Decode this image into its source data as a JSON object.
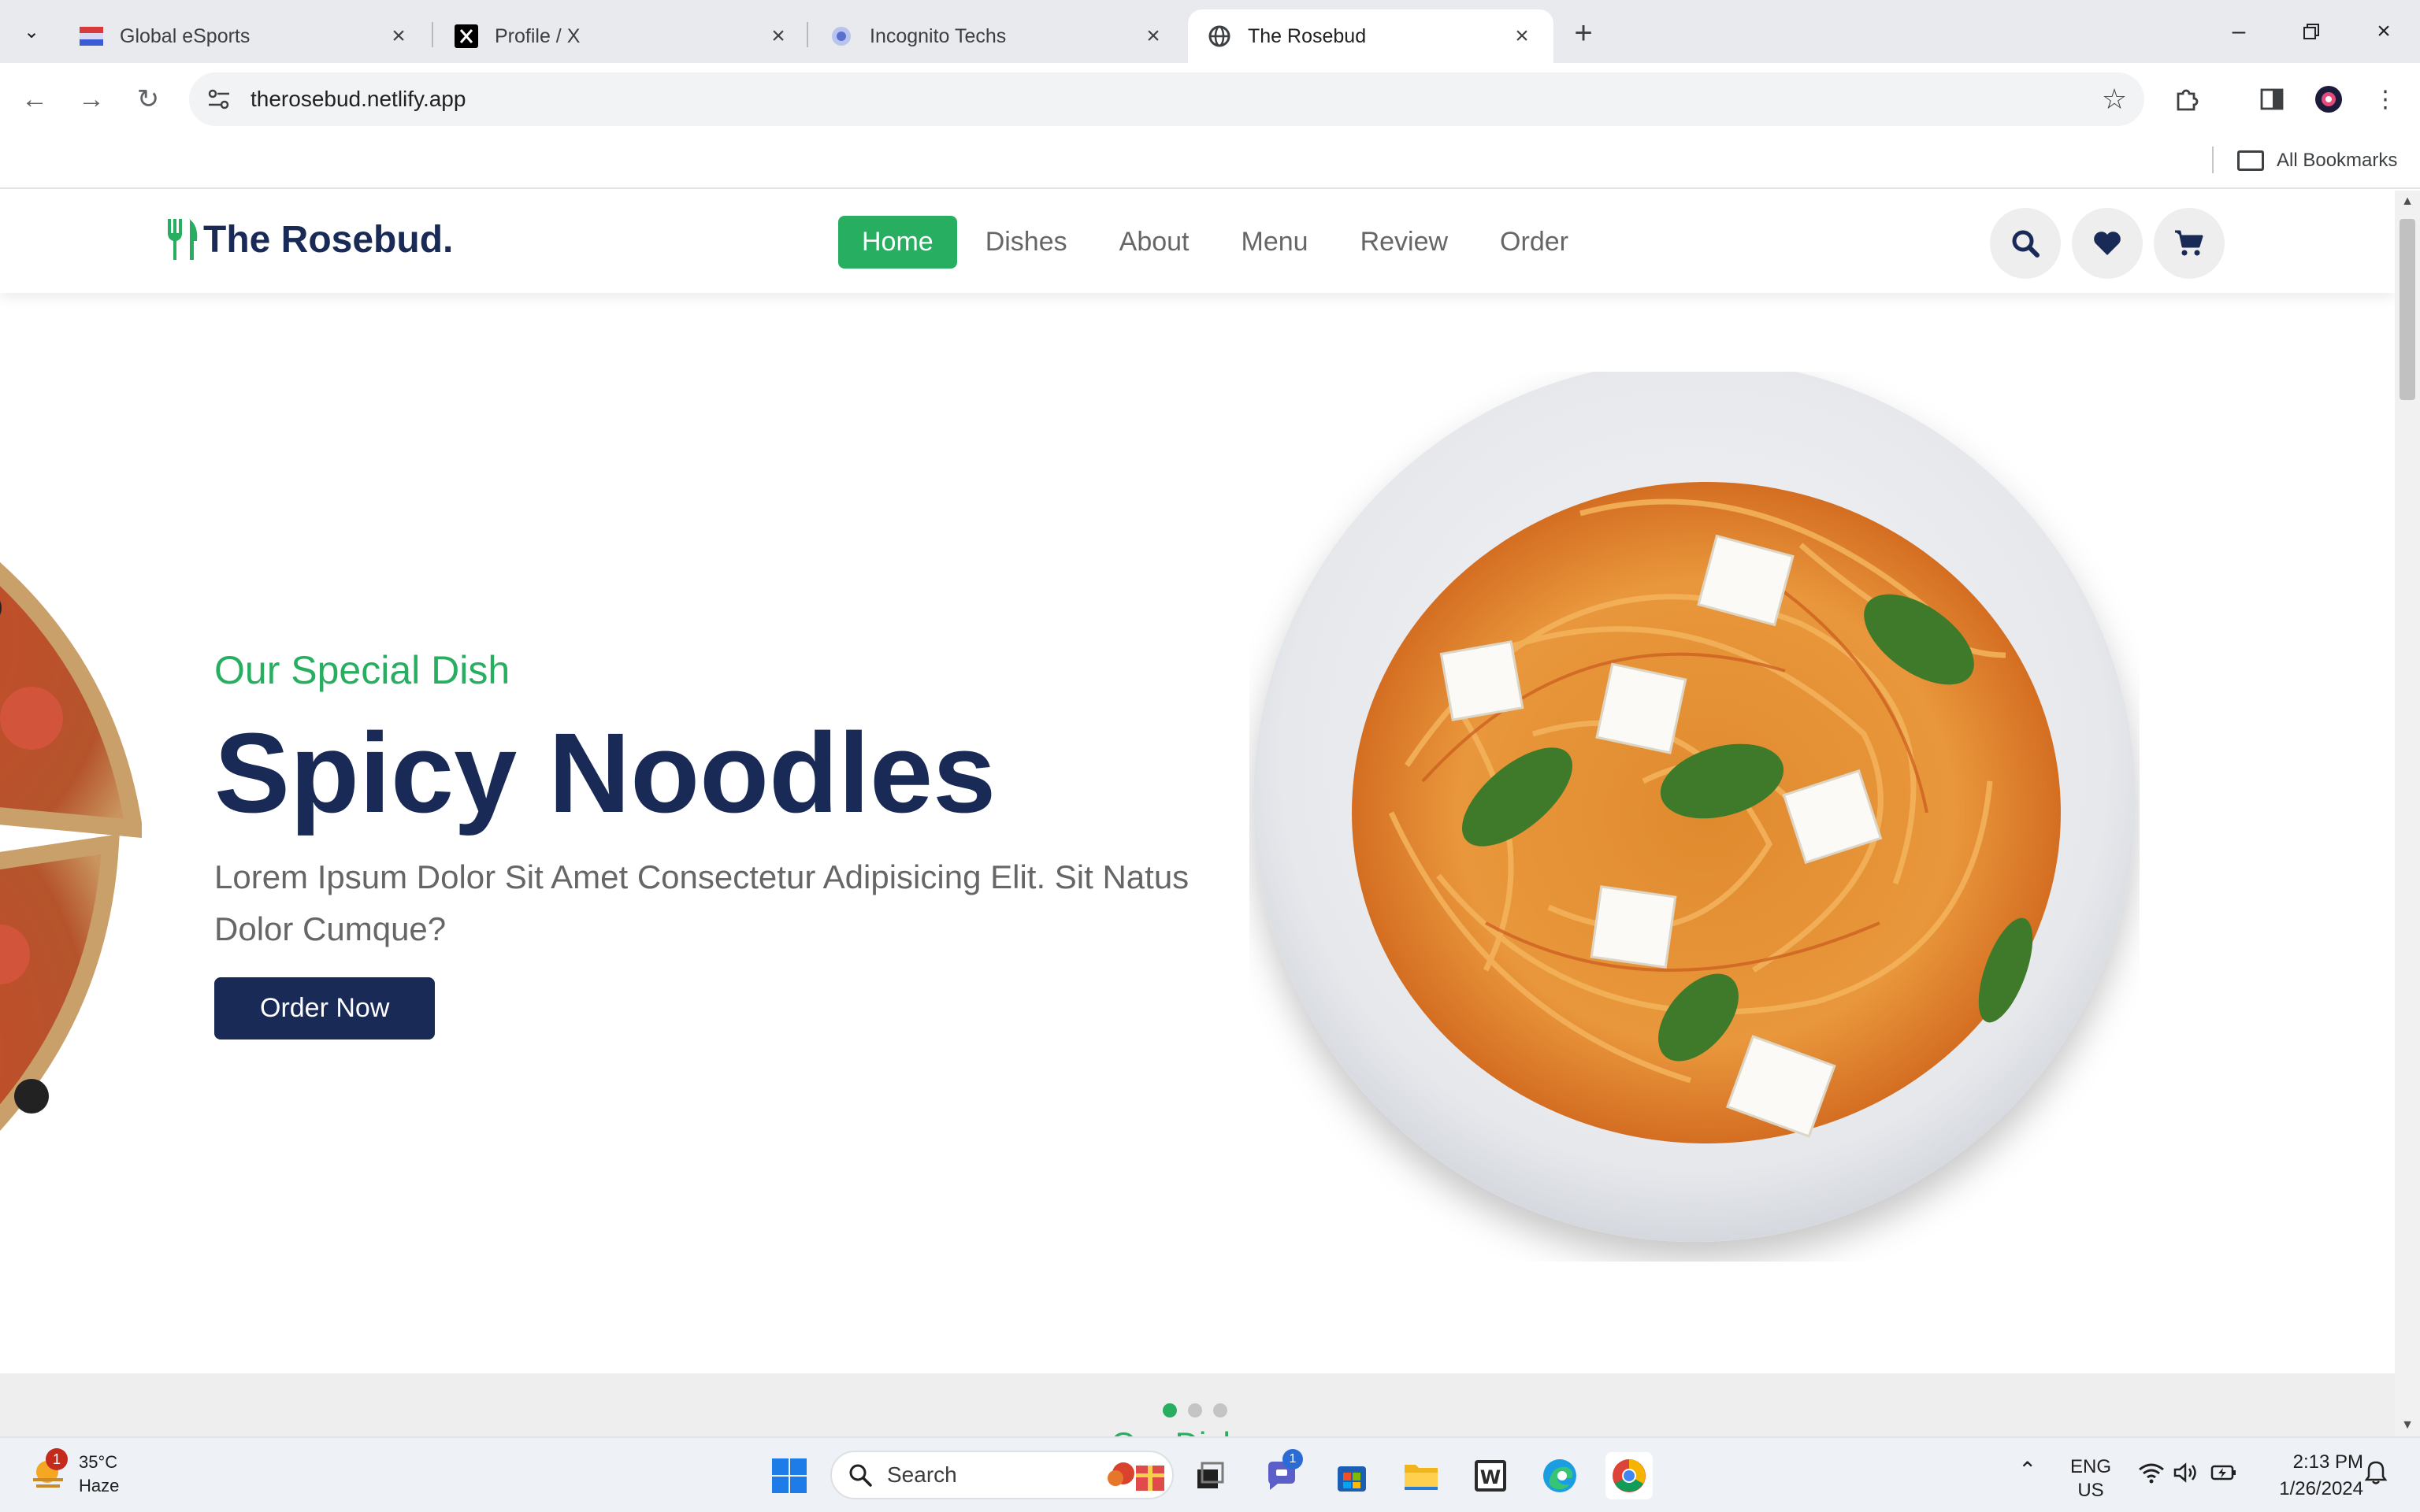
{
  "browser": {
    "tabs": [
      {
        "title": "Global eSports",
        "favicon": "global-esports-flag-icon"
      },
      {
        "title": "Profile / X",
        "favicon": "x-logo-icon"
      },
      {
        "title": "Incognito Techs",
        "favicon": "incognito-techs-icon"
      },
      {
        "title": "The Rosebud",
        "favicon": "globe-icon",
        "active": true
      }
    ],
    "url": "therosebud.netlify.app",
    "bookmarks_label": "All Bookmarks"
  },
  "site": {
    "logo_text": "The Rosebud.",
    "nav": [
      {
        "label": "Home",
        "active": true
      },
      {
        "label": "Dishes"
      },
      {
        "label": "About"
      },
      {
        "label": "Menu"
      },
      {
        "label": "Review"
      },
      {
        "label": "Order"
      }
    ],
    "header_icons": [
      "search-icon",
      "heart-icon",
      "cart-icon"
    ],
    "hero": {
      "subtitle": "Our Special Dish",
      "title": "Spicy Noodles",
      "description": "Lorem Ipsum Dolor Sit Amet Consectetur Adipisicing Elit. Sit Natus Dolor Cumque?",
      "button": "Order Now"
    },
    "slider_dots": 3,
    "slider_active_dot": 0,
    "next_section_heading": "Our Dishes"
  },
  "taskbar": {
    "weather": {
      "temp": "35°C",
      "condition": "Haze",
      "badge": "1"
    },
    "search_placeholder": "Search",
    "teams_badge": "1",
    "language": {
      "line1": "ENG",
      "line2": "US"
    },
    "time": "2:13 PM",
    "date": "1/26/2024"
  },
  "colors": {
    "brand_green": "#27ae60",
    "brand_navy": "#192a56",
    "body_text": "#666666"
  }
}
